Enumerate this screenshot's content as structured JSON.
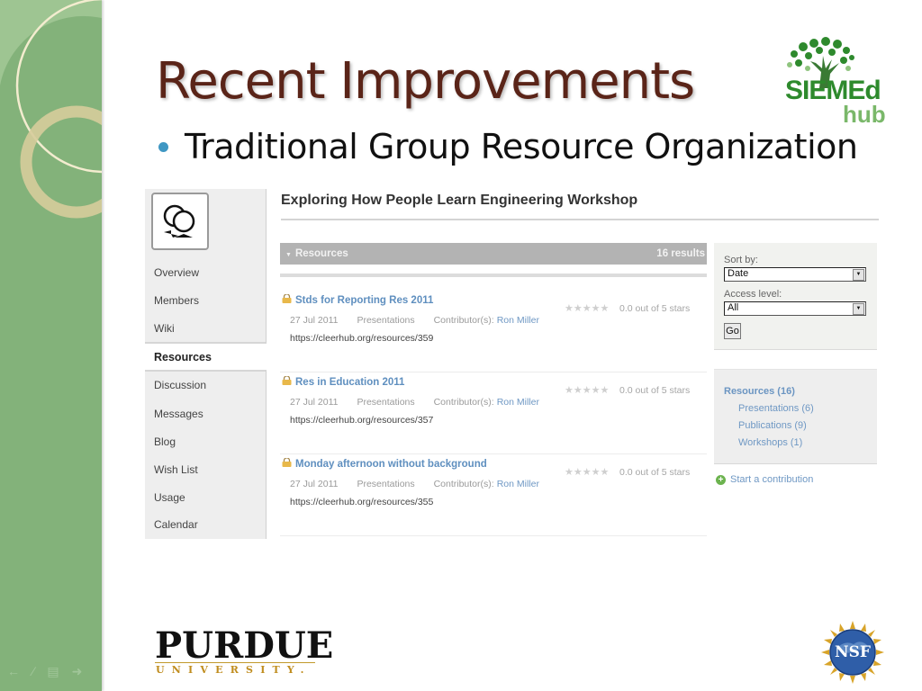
{
  "slide": {
    "title": "Recent Improvements",
    "bullet": "Traditional Group Resource Organization",
    "accent_title_color": "#5a2418",
    "bullet_color": "#3f97c3",
    "band_color": "#83b27a"
  },
  "logos": {
    "siemed_word": "SIEMEd",
    "siemed_hub": "hub",
    "purdue_name": "PURDUE",
    "purdue_sub": "UNIVERSITY.",
    "nsf": "NSF"
  },
  "slide_controls": [
    "back-arrow",
    "pen",
    "menu",
    "forward-arrow"
  ],
  "group_page": {
    "title": "Exploring How People Learn Engineering Workshop",
    "nav": [
      {
        "label": "Overview",
        "active": false
      },
      {
        "label": "Members",
        "active": false
      },
      {
        "label": "Wiki",
        "active": false
      },
      {
        "label": "Resources",
        "active": true
      },
      {
        "label": "Discussion",
        "active": false
      },
      {
        "label": "Messages",
        "active": false
      },
      {
        "label": "Blog",
        "active": false
      },
      {
        "label": "Wish List",
        "active": false
      },
      {
        "label": "Usage",
        "active": false
      },
      {
        "label": "Calendar",
        "active": false
      }
    ],
    "resources_bar": {
      "label": "Resources",
      "count": "16 results"
    },
    "items": [
      {
        "title": "Stds for Reporting Res 2011",
        "date": "27 Jul 2011",
        "type": "Presentations",
        "contributor_label": "Contributor(s):",
        "contributor": "Ron Miller",
        "url": "https://cleerhub.org/resources/359",
        "stars": "★★★★★",
        "rating": "0.0 out of 5 stars",
        "rating_value": 0.0
      },
      {
        "title": "Res in Education 2011",
        "date": "27 Jul 2011",
        "type": "Presentations",
        "contributor_label": "Contributor(s):",
        "contributor": "Ron Miller",
        "url": "https://cleerhub.org/resources/357",
        "stars": "★★★★★",
        "rating": "0.0 out of 5 stars",
        "rating_value": 0.0
      },
      {
        "title": "Monday afternoon without background",
        "date": "27 Jul 2011",
        "type": "Presentations",
        "contributor_label": "Contributor(s):",
        "contributor": "Ron Miller",
        "url": "https://cleerhub.org/resources/355",
        "stars": "★★★★★",
        "rating": "0.0 out of 5 stars",
        "rating_value": 0.0
      }
    ],
    "filters": {
      "sort_label": "Sort by:",
      "sort_value": "Date",
      "access_label": "Access level:",
      "access_value": "All",
      "go_label": "Go"
    },
    "categories": {
      "head": "Resources (16)",
      "items": [
        "Presentations (6)",
        "Publications (9)",
        "Workshops (1)"
      ]
    },
    "start_contribution": "Start a contribution",
    "link_color": "#6f98c4"
  }
}
